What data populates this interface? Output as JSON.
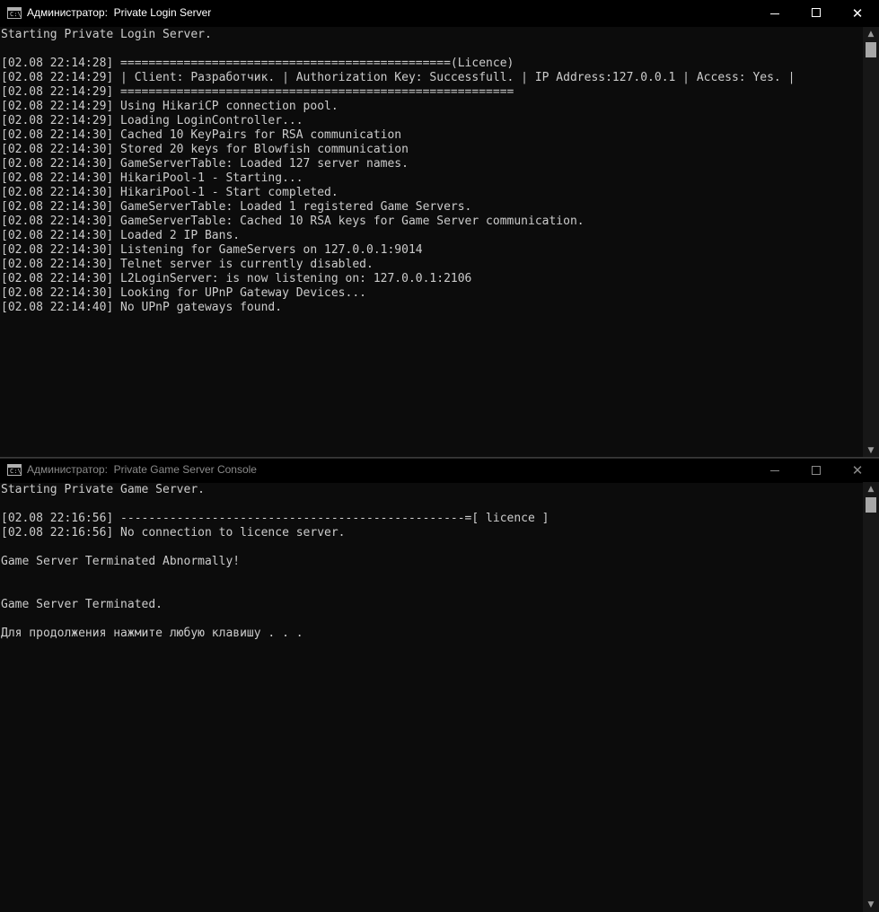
{
  "windows": [
    {
      "title": "Администратор:  Private Login Server",
      "icon": "console-icon",
      "lines": [
        "Starting Private Login Server.",
        "",
        "[02.08 22:14:28] ===============================================(Licence)",
        "[02.08 22:14:29] | Client: Разработчик. | Authorization Key: Successfull. | IP Address:127.0.0.1 | Access: Yes. |",
        "[02.08 22:14:29] ========================================================",
        "[02.08 22:14:29] Using HikariCP connection pool.",
        "[02.08 22:14:29] Loading LoginController...",
        "[02.08 22:14:30] Cached 10 KeyPairs for RSA communication",
        "[02.08 22:14:30] Stored 20 keys for Blowfish communication",
        "[02.08 22:14:30] GameServerTable: Loaded 127 server names.",
        "[02.08 22:14:30] HikariPool-1 - Starting...",
        "[02.08 22:14:30] HikariPool-1 - Start completed.",
        "[02.08 22:14:30] GameServerTable: Loaded 1 registered Game Servers.",
        "[02.08 22:14:30] GameServerTable: Cached 10 RSA keys for Game Server communication.",
        "[02.08 22:14:30] Loaded 2 IP Bans.",
        "[02.08 22:14:30] Listening for GameServers on 127.0.0.1:9014",
        "[02.08 22:14:30] Telnet server is currently disabled.",
        "[02.08 22:14:30] L2LoginServer: is now listening on: 127.0.0.1:2106",
        "[02.08 22:14:30] Looking for UPnP Gateway Devices...",
        "[02.08 22:14:40] No UPnP gateways found."
      ]
    },
    {
      "title": "Администратор:  Private Game Server Console",
      "icon": "console-icon",
      "lines": [
        "Starting Private Game Server.",
        "",
        "[02.08 22:16:56] -------------------------------------------------=[ licence ]",
        "[02.08 22:16:56] No connection to licence server.",
        "",
        "Game Server Terminated Abnormally!",
        "",
        "",
        "Game Server Terminated.",
        "",
        "Для продолжения нажмите любую клавишу . . ."
      ]
    }
  ],
  "controls": {
    "minimize": "minimize-icon",
    "maximize": "maximize-icon",
    "close": "close-icon"
  },
  "colors": {
    "background": "#0c0c0c",
    "text": "#cccccc",
    "titlebar": "#000000",
    "inactive_title": "#8a8a8a"
  }
}
